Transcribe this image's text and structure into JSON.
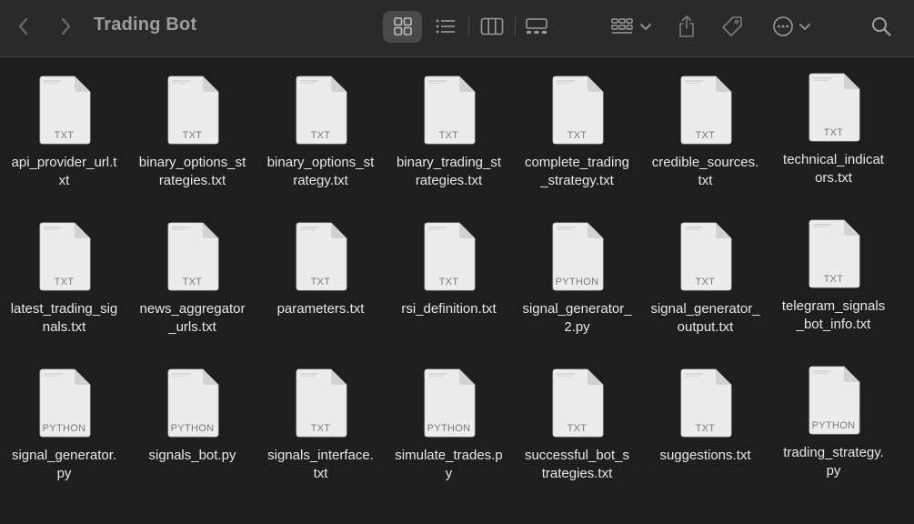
{
  "window": {
    "title": "Trading Bot"
  },
  "toolbar": {
    "back_icon": "chevron-left-icon",
    "forward_icon": "chevron-right-icon",
    "view_icons": "grid-view-icon",
    "view_list": "list-view-icon",
    "view_columns": "column-view-icon",
    "view_gallery": "gallery-view-icon",
    "group_icon": "group-by-icon",
    "share_icon": "share-icon",
    "tag_icon": "tag-icon",
    "more_icon": "more-actions-icon",
    "search_icon": "search-icon"
  },
  "files": [
    {
      "name": "api_provider_url.t\nxt",
      "type": "TXT"
    },
    {
      "name": "binary_options_st\nrategies.txt",
      "type": "TXT"
    },
    {
      "name": "binary_options_st\nrategy.txt",
      "type": "TXT"
    },
    {
      "name": "binary_trading_st\nrategies.txt",
      "type": "TXT"
    },
    {
      "name": "complete_trading\n_strategy.txt",
      "type": "TXT"
    },
    {
      "name": "credible_sources.\ntxt",
      "type": "TXT"
    },
    {
      "name": "technical_indicat\nors.txt",
      "type": "TXT"
    },
    {
      "name": "latest_trading_sig\nnals.txt",
      "type": "TXT"
    },
    {
      "name": "news_aggregator\n_urls.txt",
      "type": "TXT"
    },
    {
      "name": "parameters.txt",
      "type": "TXT"
    },
    {
      "name": "rsi_definition.txt",
      "type": "TXT"
    },
    {
      "name": "signal_generator_\n2.py",
      "type": "PYTHON"
    },
    {
      "name": "signal_generator_\noutput.txt",
      "type": "TXT"
    },
    {
      "name": "telegram_signals\n_bot_info.txt",
      "type": "TXT"
    },
    {
      "name": "signal_generator.\npy",
      "type": "PYTHON"
    },
    {
      "name": "signals_bot.py",
      "type": "PYTHON"
    },
    {
      "name": "signals_interface.\ntxt",
      "type": "TXT"
    },
    {
      "name": "simulate_trades.p\ny",
      "type": "PYTHON"
    },
    {
      "name": "successful_bot_s\ntrategies.txt",
      "type": "TXT"
    },
    {
      "name": "suggestions.txt",
      "type": "TXT"
    },
    {
      "name": "trading_strategy.\npy",
      "type": "PYTHON"
    }
  ]
}
